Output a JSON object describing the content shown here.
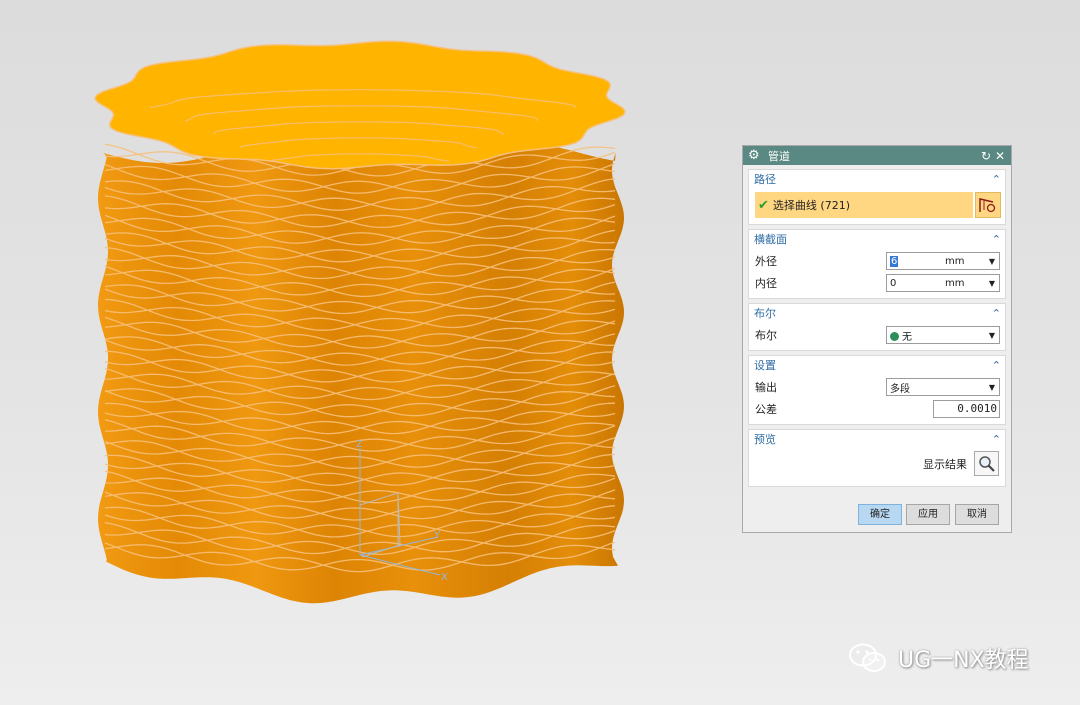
{
  "dialog": {
    "title": "管道",
    "sections": {
      "path": {
        "title": "路径",
        "select_label": "选择曲线 (721)"
      },
      "cross_section": {
        "title": "横截面",
        "outer_diameter": {
          "label": "外径",
          "value": "6",
          "unit": "mm"
        },
        "inner_diameter": {
          "label": "内径",
          "value": "0",
          "unit": "mm"
        }
      },
      "boolean": {
        "title": "布尔",
        "label": "布尔",
        "value": "无"
      },
      "settings": {
        "title": "设置",
        "output": {
          "label": "输出",
          "value": "多段"
        },
        "tolerance": {
          "label": "公差",
          "value": "0.0010"
        }
      },
      "preview": {
        "title": "预览",
        "show_result_label": "显示结果"
      }
    },
    "buttons": {
      "ok": "确定",
      "apply": "应用",
      "cancel": "取消"
    }
  },
  "viewport": {
    "model_color": "#e8900a",
    "top_color": "#ffb400",
    "curve_color": "#f7c07a",
    "axes": {
      "x": "X",
      "y": "Y",
      "z": "Z"
    }
  },
  "watermark": {
    "text": "UG一NX教程",
    "icon": "wechat-icon"
  }
}
